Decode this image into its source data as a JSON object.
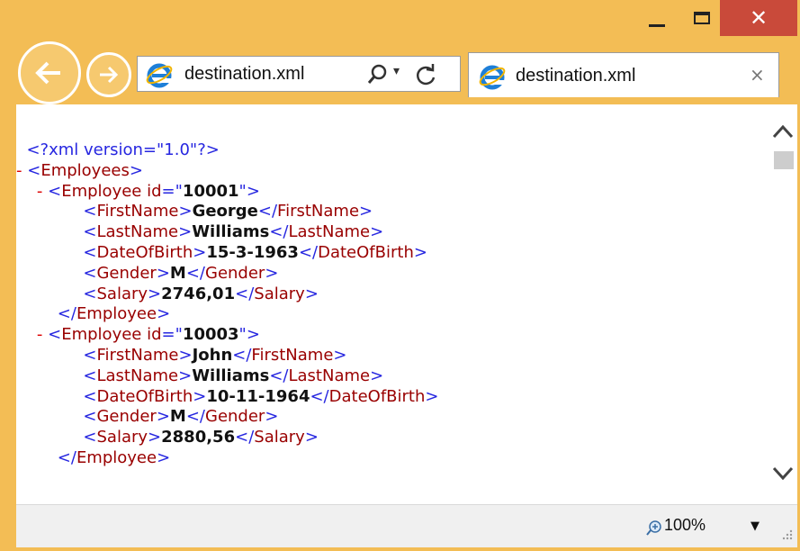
{
  "window": {
    "minimize_icon": "minimize-icon",
    "maximize_icon": "maximize-icon",
    "close_label": "✕",
    "titlebar_color": "#f3bd55",
    "close_color": "#c94a3a"
  },
  "nav": {
    "back_icon": "back-arrow-icon",
    "forward_icon": "forward-arrow-icon"
  },
  "address": {
    "url": "destination.xml",
    "search_icon": "search-icon",
    "dropdown_glyph": "▾",
    "refresh_icon": "refresh-icon"
  },
  "tab": {
    "title": "destination.xml",
    "close_label": "×"
  },
  "xml": {
    "declaration": "<?xml version=\"1.0\"?>",
    "dash": "-",
    "root": "Employees",
    "employees": [
      {
        "id_attr": "id",
        "id": "10001",
        "first_name": "George",
        "last_name": "Williams",
        "date_of_birth": "15-3-1963",
        "gender": "M",
        "salary": "2746,01"
      },
      {
        "id_attr": "id",
        "id": "10003",
        "first_name": "John",
        "last_name": "Williams",
        "date_of_birth": "10-11-1964",
        "gender": "M",
        "salary": "2880,56"
      }
    ],
    "tags": {
      "employee": "Employee",
      "first_name": "FirstName",
      "last_name": "LastName",
      "date_of_birth": "DateOfBirth",
      "gender": "Gender",
      "salary": "Salary"
    },
    "colors": {
      "markup": "#2626e0",
      "tag_name": "#990000",
      "value": "#111111",
      "collapse_dash": "#dd0000"
    }
  },
  "status": {
    "zoom_icon": "zoom-icon",
    "zoom": "100%",
    "zoom_dropdown": "▼"
  }
}
